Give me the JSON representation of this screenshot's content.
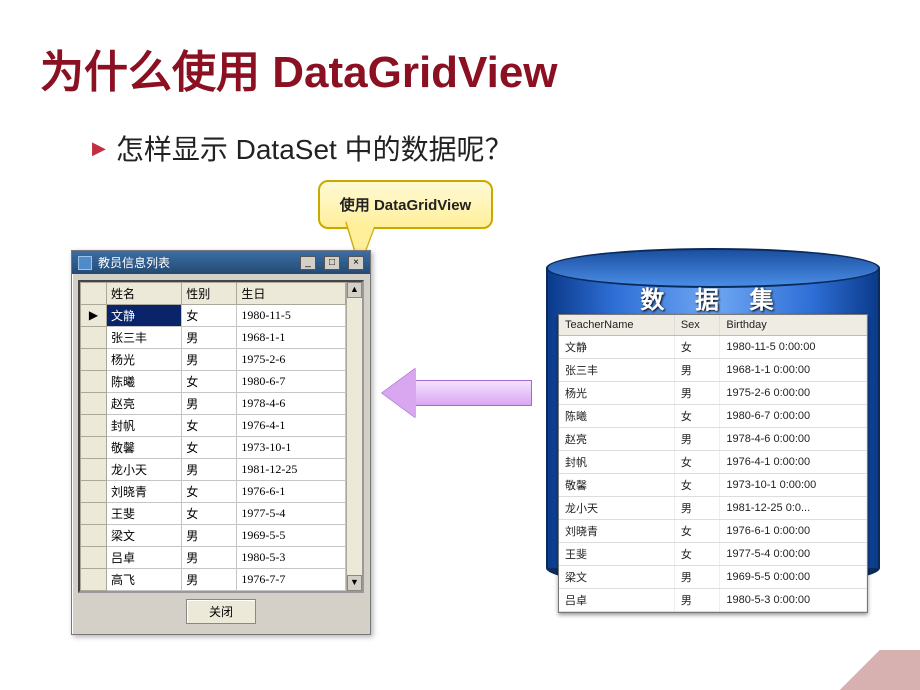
{
  "title": "为什么使用 DataGridView",
  "bullet": "怎样显示 DataSet 中的数据呢？",
  "callout": "使用 DataGridView",
  "winform": {
    "title": "教员信息列表",
    "columns": {
      "name": "姓名",
      "sex": "性别",
      "birthday": "生日"
    },
    "rows": [
      {
        "name": "文静",
        "sex": "女",
        "birthday": "1980-11-5",
        "selected": true
      },
      {
        "name": "张三丰",
        "sex": "男",
        "birthday": "1968-1-1"
      },
      {
        "name": "杨光",
        "sex": "男",
        "birthday": "1975-2-6"
      },
      {
        "name": "陈曦",
        "sex": "女",
        "birthday": "1980-6-7"
      },
      {
        "name": "赵亮",
        "sex": "男",
        "birthday": "1978-4-6"
      },
      {
        "name": "封帆",
        "sex": "女",
        "birthday": "1976-4-1"
      },
      {
        "name": "敬馨",
        "sex": "女",
        "birthday": "1973-10-1"
      },
      {
        "name": "龙小天",
        "sex": "男",
        "birthday": "1981-12-25"
      },
      {
        "name": "刘晓青",
        "sex": "女",
        "birthday": "1976-6-1"
      },
      {
        "name": "王斐",
        "sex": "女",
        "birthday": "1977-5-4"
      },
      {
        "name": "梁文",
        "sex": "男",
        "birthday": "1969-5-5"
      },
      {
        "name": "吕卓",
        "sex": "男",
        "birthday": "1980-5-3"
      },
      {
        "name": "高飞",
        "sex": "男",
        "birthday": "1976-7-7"
      }
    ],
    "close_label": "关闭"
  },
  "dataset": {
    "title": "数 据 集",
    "columns": {
      "name": "TeacherName",
      "sex": "Sex",
      "birthday": "Birthday"
    },
    "rows": [
      {
        "name": "文静",
        "sex": "女",
        "birthday": "1980-11-5 0:00:00"
      },
      {
        "name": "张三丰",
        "sex": "男",
        "birthday": "1968-1-1 0:00:00"
      },
      {
        "name": "杨光",
        "sex": "男",
        "birthday": "1975-2-6 0:00:00"
      },
      {
        "name": "陈曦",
        "sex": "女",
        "birthday": "1980-6-7 0:00:00"
      },
      {
        "name": "赵亮",
        "sex": "男",
        "birthday": "1978-4-6 0:00:00"
      },
      {
        "name": "封帆",
        "sex": "女",
        "birthday": "1976-4-1 0:00:00"
      },
      {
        "name": "敬馨",
        "sex": "女",
        "birthday": "1973-10-1 0:00:00"
      },
      {
        "name": "龙小天",
        "sex": "男",
        "birthday": "1981-12-25 0:0..."
      },
      {
        "name": "刘晓青",
        "sex": "女",
        "birthday": "1976-6-1 0:00:00"
      },
      {
        "name": "王斐",
        "sex": "女",
        "birthday": "1977-5-4 0:00:00"
      },
      {
        "name": "梁文",
        "sex": "男",
        "birthday": "1969-5-5 0:00:00"
      },
      {
        "name": "吕卓",
        "sex": "男",
        "birthday": "1980-5-3 0:00:00"
      }
    ]
  }
}
